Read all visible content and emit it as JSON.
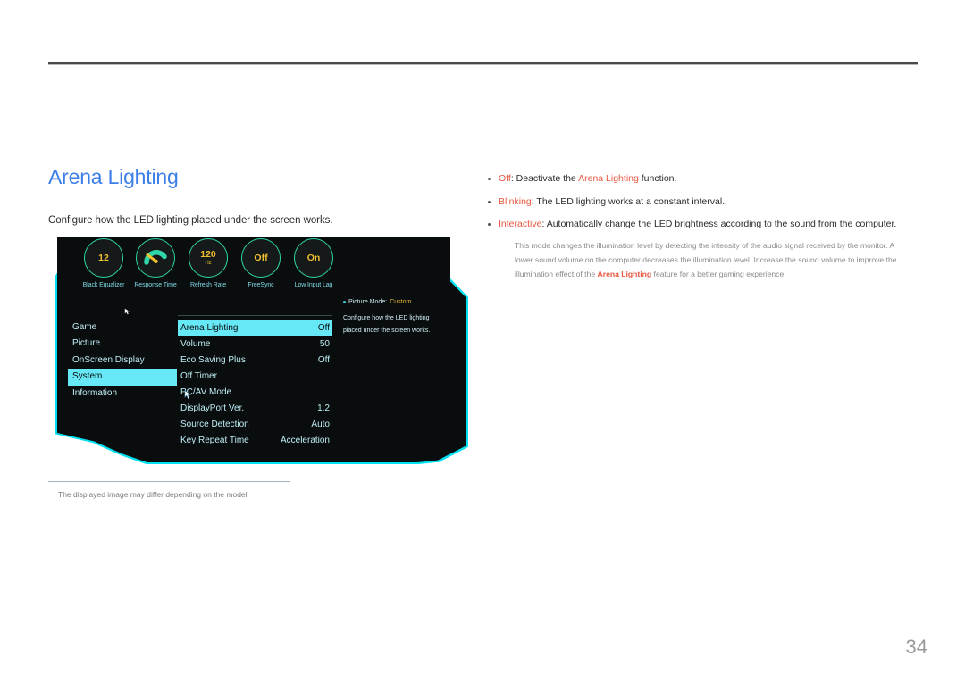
{
  "page": {
    "number": "34",
    "title": "Arena Lighting",
    "intro": "Configure how the LED lighting placed under the screen works.",
    "footnote": "The displayed image may differ depending on the model.",
    "accent_blue": "#3c7fe8",
    "accent_orange": "#e8573f",
    "osd_cyan": "#67e8f6",
    "osd_gold": "#f0bf2e"
  },
  "osd": {
    "dials": [
      {
        "value": "12",
        "unit": "",
        "label": "Black Equalizer",
        "icon": "number-dial-icon"
      },
      {
        "value": "",
        "unit": "",
        "label": "Response Time",
        "icon": "gauge-icon"
      },
      {
        "value": "120",
        "unit": "Hz",
        "label": "Refresh Rate",
        "icon": "number-dial-icon"
      },
      {
        "value": "Off",
        "unit": "",
        "label": "FreeSync",
        "icon": "toggle-dial-icon"
      },
      {
        "value": "On",
        "unit": "",
        "label": "Low Input Lag",
        "icon": "toggle-dial-icon"
      }
    ],
    "nav": [
      {
        "label": "Game",
        "selected": false
      },
      {
        "label": "Picture",
        "selected": false
      },
      {
        "label": "OnScreen Display",
        "selected": false
      },
      {
        "label": "System",
        "selected": true
      },
      {
        "label": "Information",
        "selected": false
      }
    ],
    "menu": [
      {
        "label": "Arena Lighting",
        "value": "Off",
        "selected": true
      },
      {
        "label": "Volume",
        "value": "50",
        "selected": false
      },
      {
        "label": "Eco Saving Plus",
        "value": "Off",
        "selected": false
      },
      {
        "label": "Off Timer",
        "value": "",
        "selected": false
      },
      {
        "label": "PC/AV Mode",
        "value": "",
        "selected": false
      },
      {
        "label": "DisplayPort Ver.",
        "value": "1.2",
        "selected": false
      },
      {
        "label": "Source Detection",
        "value": "Auto",
        "selected": false
      },
      {
        "label": "Key Repeat Time",
        "value": "Acceleration",
        "selected": false
      }
    ],
    "info": {
      "picture_mode_label": "Picture Mode:",
      "picture_mode_value": "Custom",
      "description": "Configure how the LED lighting placed under the screen works."
    }
  },
  "options": [
    {
      "keyword": "Off",
      "text_before": ": Deactivate the ",
      "inline_keyword": "Arena Lighting",
      "text_after": " function."
    },
    {
      "keyword": "Blinking",
      "text_before": ": The LED lighting works at a constant interval.",
      "inline_keyword": "",
      "text_after": ""
    },
    {
      "keyword": "Interactive",
      "text_before": ": Automatically change the LED brightness according to the sound from the computer.",
      "inline_keyword": "",
      "text_after": ""
    }
  ],
  "subnote": {
    "part1": "This mode changes the illumination level by detecting the intensity of the audio signal received by the monitor. A lower sound volume on the computer decreases the illumination level. Increase the sound volume to improve the illumination effect of the ",
    "keyword": "Arena Lighting",
    "part2": " feature for a better gaming experience."
  }
}
